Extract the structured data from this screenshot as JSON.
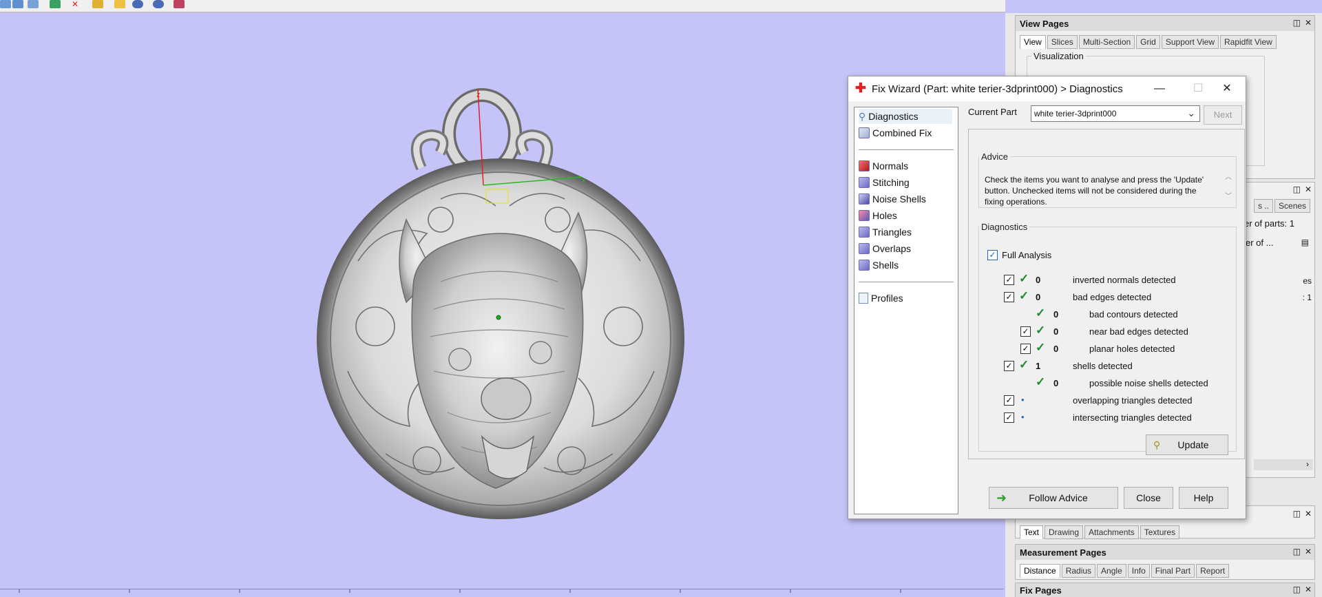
{
  "toolbar": {
    "icons": [
      "part-icon",
      "box-icon",
      "plane-icon",
      "delete-icon",
      "wand-icon",
      "pin-icon",
      "sphere-icon",
      "globe-icon",
      "render-icon"
    ]
  },
  "viewport": {
    "background": "#c4c4f8",
    "model": "pendant with dog head",
    "axes": {
      "x": "x",
      "z": "z"
    }
  },
  "panels": {
    "view_pages": {
      "title": "View Pages",
      "tabs": [
        "View",
        "Slices",
        "Multi-Section",
        "Grid",
        "Support View",
        "Rapidfit View"
      ],
      "active_tab": "View",
      "group_label": "Visualization"
    },
    "middle": {
      "tabs": [
        "s ..",
        "Scenes"
      ],
      "number_of_parts_label": "er of parts: 1",
      "number_of_label": "er of ...",
      "stub_es": "es",
      "stub_ratio": ": 1"
    },
    "text_pages": {
      "tabs": [
        "Text",
        "Drawing",
        "Attachments",
        "Textures"
      ],
      "active_tab": "Text"
    },
    "measurement_pages": {
      "title": "Measurement Pages",
      "tabs": [
        "Distance",
        "Radius",
        "Angle",
        "Info",
        "Final Part",
        "Report"
      ],
      "active_tab": "Distance"
    },
    "fix_pages": {
      "title": "Fix Pages"
    }
  },
  "dialog": {
    "title": "Fix Wizard (Part: white terier-3dprint000) > Diagnostics",
    "controls": {
      "minimize": "—",
      "maximize": "☐",
      "close": "✕"
    },
    "nav": {
      "top": [
        "Diagnostics",
        "Combined Fix"
      ],
      "middle": [
        "Normals",
        "Stitching",
        "Noise Shells",
        "Holes",
        "Triangles",
        "Overlaps",
        "Shells"
      ],
      "bottom": [
        "Profiles"
      ]
    },
    "current_part_label": "Current Part",
    "current_part_value": "white terier-3dprint000",
    "next_label": "Next",
    "advice": {
      "legend": "Advice",
      "text": "Check the items you want to analyse and press the 'Update' button. Unchecked items will not be considered during the fixing operations."
    },
    "diagnostics": {
      "legend": "Diagnostics",
      "full_analysis_label": "Full Analysis",
      "rows": [
        {
          "count": "0",
          "label": "inverted normals detected"
        },
        {
          "count": "0",
          "label": "bad edges detected"
        },
        {
          "count": "0",
          "label": "bad contours detected"
        },
        {
          "count": "0",
          "label": "near bad edges detected"
        },
        {
          "count": "0",
          "label": "planar holes detected"
        },
        {
          "count": "1",
          "label": "shells detected"
        },
        {
          "count": "0",
          "label": "possible noise shells detected"
        },
        {
          "count": "•",
          "label": "overlapping triangles detected"
        },
        {
          "count": "•",
          "label": "intersecting triangles detected"
        }
      ],
      "update_label": "Update"
    },
    "buttons": {
      "follow_advice": "Follow Advice",
      "close": "Close",
      "help": "Help"
    }
  },
  "colors": {
    "viewport_bg": "#c4c4f8",
    "tick_green": "#1d8a2e",
    "check_blue": "#1f64c8",
    "title_red": "#e02020"
  }
}
